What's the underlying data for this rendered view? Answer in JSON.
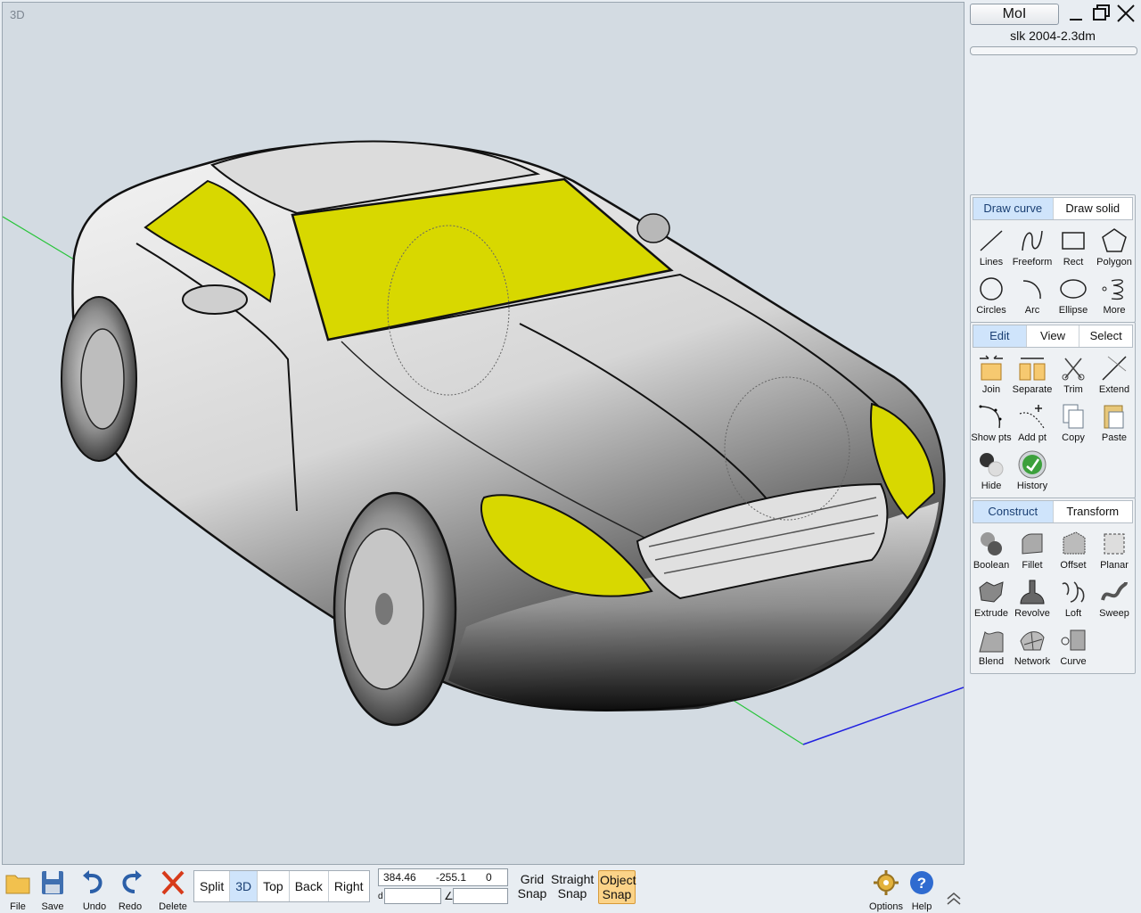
{
  "viewport": {
    "label": "3D"
  },
  "header": {
    "app_button": "MoI",
    "document": "slk 2004-2.3dm"
  },
  "draw_palette": {
    "tabs": [
      {
        "label": "Draw curve",
        "active": true
      },
      {
        "label": "Draw solid",
        "active": false
      }
    ],
    "tools": [
      {
        "label": "Lines",
        "icon": "lines-icon"
      },
      {
        "label": "Freeform",
        "icon": "freeform-icon"
      },
      {
        "label": "Rect",
        "icon": "rect-icon"
      },
      {
        "label": "Polygon",
        "icon": "polygon-icon"
      },
      {
        "label": "Circles",
        "icon": "circle-icon"
      },
      {
        "label": "Arc",
        "icon": "arc-icon"
      },
      {
        "label": "Ellipse",
        "icon": "ellipse-icon"
      },
      {
        "label": "More",
        "icon": "more-curves-icon"
      }
    ]
  },
  "edit_palette": {
    "tabs": [
      {
        "label": "Edit",
        "active": true
      },
      {
        "label": "View",
        "active": false
      },
      {
        "label": "Select",
        "active": false
      }
    ],
    "tools": [
      {
        "label": "Join",
        "icon": "join-icon"
      },
      {
        "label": "Separate",
        "icon": "separate-icon"
      },
      {
        "label": "Trim",
        "icon": "trim-icon"
      },
      {
        "label": "Extend",
        "icon": "extend-icon"
      },
      {
        "label": "Show pts",
        "icon": "show-points-icon"
      },
      {
        "label": "Add pt",
        "icon": "add-point-icon"
      },
      {
        "label": "Copy",
        "icon": "copy-icon"
      },
      {
        "label": "Paste",
        "icon": "paste-icon"
      },
      {
        "label": "Hide",
        "icon": "hide-icon"
      },
      {
        "label": "History",
        "icon": "history-icon"
      }
    ]
  },
  "construct_palette": {
    "tabs": [
      {
        "label": "Construct",
        "active": true
      },
      {
        "label": "Transform",
        "active": false
      }
    ],
    "tools": [
      {
        "label": "Boolean",
        "icon": "boolean-icon"
      },
      {
        "label": "Fillet",
        "icon": "fillet-icon"
      },
      {
        "label": "Offset",
        "icon": "offset-icon"
      },
      {
        "label": "Planar",
        "icon": "planar-icon"
      },
      {
        "label": "Extrude",
        "icon": "extrude-icon"
      },
      {
        "label": "Revolve",
        "icon": "revolve-icon"
      },
      {
        "label": "Loft",
        "icon": "loft-icon"
      },
      {
        "label": "Sweep",
        "icon": "sweep-icon"
      },
      {
        "label": "Blend",
        "icon": "blend-icon"
      },
      {
        "label": "Network",
        "icon": "network-icon"
      },
      {
        "label": "Curve",
        "icon": "curve-icon"
      }
    ]
  },
  "bottom_bar": {
    "file": "File",
    "save": "Save",
    "undo": "Undo",
    "redo": "Redo",
    "delete": "Delete",
    "views": [
      {
        "label": "Split",
        "active": false
      },
      {
        "label": "3D",
        "active": true
      },
      {
        "label": "Top",
        "active": false
      },
      {
        "label": "Back",
        "active": false
      },
      {
        "label": "Right",
        "active": false
      }
    ],
    "coords": {
      "x": "384.46",
      "y": "-255.1",
      "z": "0",
      "d_label": "d",
      "angle_label": "∠"
    },
    "grid_snap": "Grid Snap",
    "straight_snap": "Straight Snap",
    "object_snap": "Object Snap",
    "options": "Options",
    "help": "Help"
  },
  "colors": {
    "accent": "#cfe4fb",
    "selection": "#e6e600",
    "snap_active": "#fbd388"
  }
}
